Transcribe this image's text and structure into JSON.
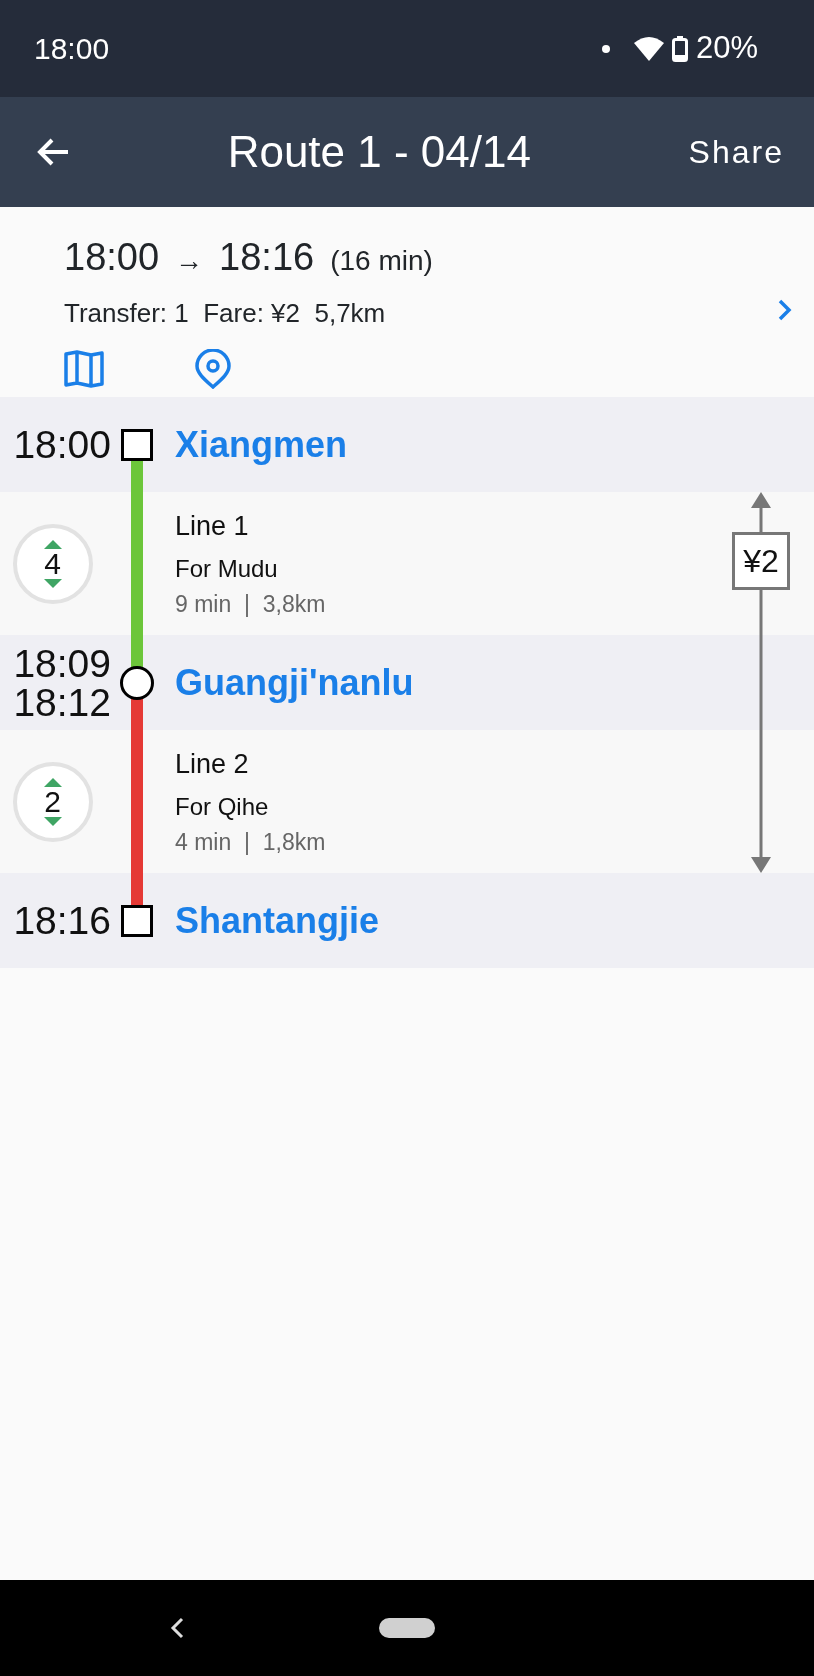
{
  "status_bar": {
    "time": "18:00",
    "battery": "20%"
  },
  "app_bar": {
    "title": "Route 1 - 04/14",
    "action": "Share"
  },
  "summary": {
    "depart": "18:00",
    "arrow": "→",
    "arrive": "18:16",
    "duration": "(16 min)",
    "details": "Transfer: 1  Fare: ¥2  5,7km"
  },
  "route": [
    {
      "kind": "stop",
      "transfer": false,
      "times": [
        "18:00"
      ],
      "name": "Xiangmen"
    },
    {
      "kind": "leg",
      "color": "#6cc63a",
      "stops": "4",
      "line": "Line 1",
      "direction": "For Mudu",
      "info": "9 min  |  3,8km"
    },
    {
      "kind": "stop",
      "transfer": true,
      "times": [
        "18:09",
        "18:12"
      ],
      "name": "Guangji'nanlu"
    },
    {
      "kind": "leg",
      "color": "#e53935",
      "stops": "2",
      "line": "Line 2",
      "direction": "For Qihe",
      "info": "4 min  |  1,8km"
    },
    {
      "kind": "stop",
      "transfer": false,
      "times": [
        "18:16"
      ],
      "name": "Shantangjie"
    }
  ],
  "fare": {
    "label": "¥2"
  }
}
